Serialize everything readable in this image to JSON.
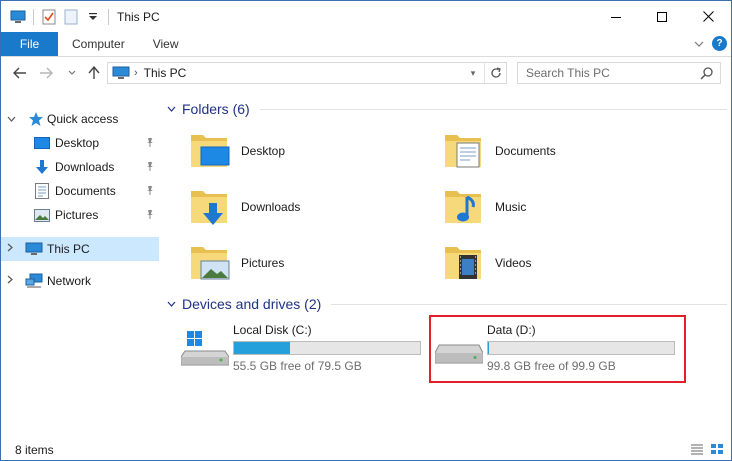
{
  "window": {
    "title": "This PC"
  },
  "ribbon": {
    "tabs": [
      "File",
      "Computer",
      "View"
    ]
  },
  "address": {
    "location": "This PC"
  },
  "search": {
    "placeholder": "Search This PC"
  },
  "nav": {
    "quick_access": "Quick access",
    "pinned": [
      {
        "label": "Desktop",
        "icon": "desktop-icon"
      },
      {
        "label": "Downloads",
        "icon": "downloads-icon"
      },
      {
        "label": "Documents",
        "icon": "documents-icon"
      },
      {
        "label": "Pictures",
        "icon": "pictures-icon"
      }
    ],
    "this_pc": "This PC",
    "network": "Network"
  },
  "folders": {
    "header": "Folders (6)",
    "items": [
      {
        "label": "Desktop",
        "icon": "desktop-folder-icon"
      },
      {
        "label": "Documents",
        "icon": "documents-folder-icon"
      },
      {
        "label": "Downloads",
        "icon": "downloads-folder-icon"
      },
      {
        "label": "Music",
        "icon": "music-folder-icon"
      },
      {
        "label": "Pictures",
        "icon": "pictures-folder-icon"
      },
      {
        "label": "Videos",
        "icon": "videos-folder-icon"
      }
    ]
  },
  "drives": {
    "header": "Devices and drives (2)",
    "items": [
      {
        "label": "Local Disk (C:)",
        "free_text": "55.5 GB free of 79.5 GB",
        "used_fraction": 0.302,
        "icon": "windows-drive-icon"
      },
      {
        "label": "Data (D:)",
        "free_text": "99.8 GB free of 99.9 GB",
        "used_fraction": 0.001,
        "icon": "hard-drive-icon"
      }
    ]
  },
  "status": {
    "item_count": "8 items"
  },
  "colors": {
    "accent": "#1979ca",
    "selection": "#cce8ff",
    "group_header": "#1e3287",
    "highlight": "#e0202a",
    "drive_bar": "#26a0da"
  }
}
